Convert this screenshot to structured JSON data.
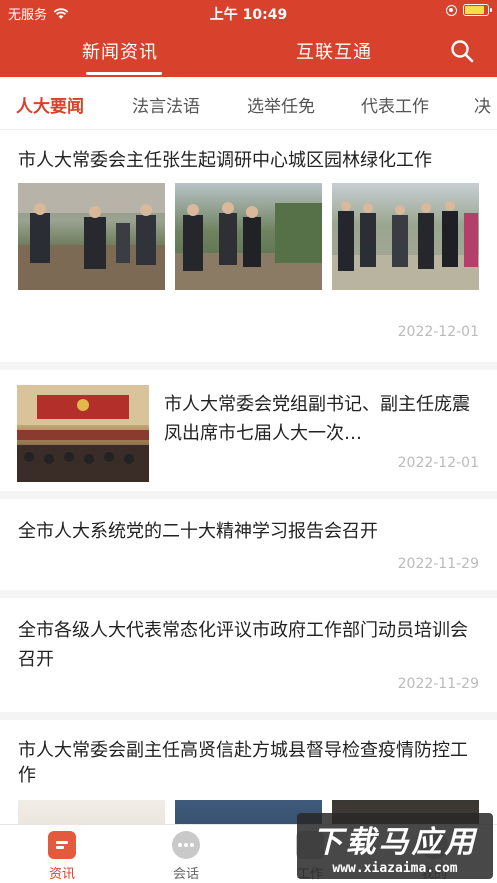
{
  "status": {
    "carrier": "无服务",
    "time": "上午 10:49",
    "battery_level": 0.85
  },
  "header": {
    "tabs": [
      {
        "label": "新闻资讯"
      },
      {
        "label": "互联互通"
      }
    ],
    "active_tab": 0
  },
  "categories": [
    {
      "label": "人大要闻"
    },
    {
      "label": "法言法语"
    },
    {
      "label": "选举任免"
    },
    {
      "label": "代表工作"
    },
    {
      "label": "决"
    }
  ],
  "active_category": 0,
  "feed": [
    {
      "title": "市人大常委会主任张生起调研中心城区园林绿化工作",
      "date": "2022-12-01"
    },
    {
      "title": "市人大常委会党组副书记、副主任庞震凤出席市七届人大一次…",
      "date": "2022-12-01"
    },
    {
      "title": "全市人大系统党的二十大精神学习报告会召开",
      "date": "2022-11-29"
    },
    {
      "title": "全市各级人大代表常态化评议市政府工作部门动员培训会召开",
      "date": "2022-11-29"
    },
    {
      "title": "市人大常委会副主任高贤信赴方城县督导检查疫情防控工作"
    }
  ],
  "bottom_nav": [
    {
      "label": "资讯"
    },
    {
      "label": "会话"
    },
    {
      "label": "工作"
    },
    {
      "label": "我的"
    }
  ],
  "watermark": {
    "title": "下载马应用",
    "url": "www.xiazaima.com"
  },
  "colors": {
    "accent": "#d8412b"
  }
}
